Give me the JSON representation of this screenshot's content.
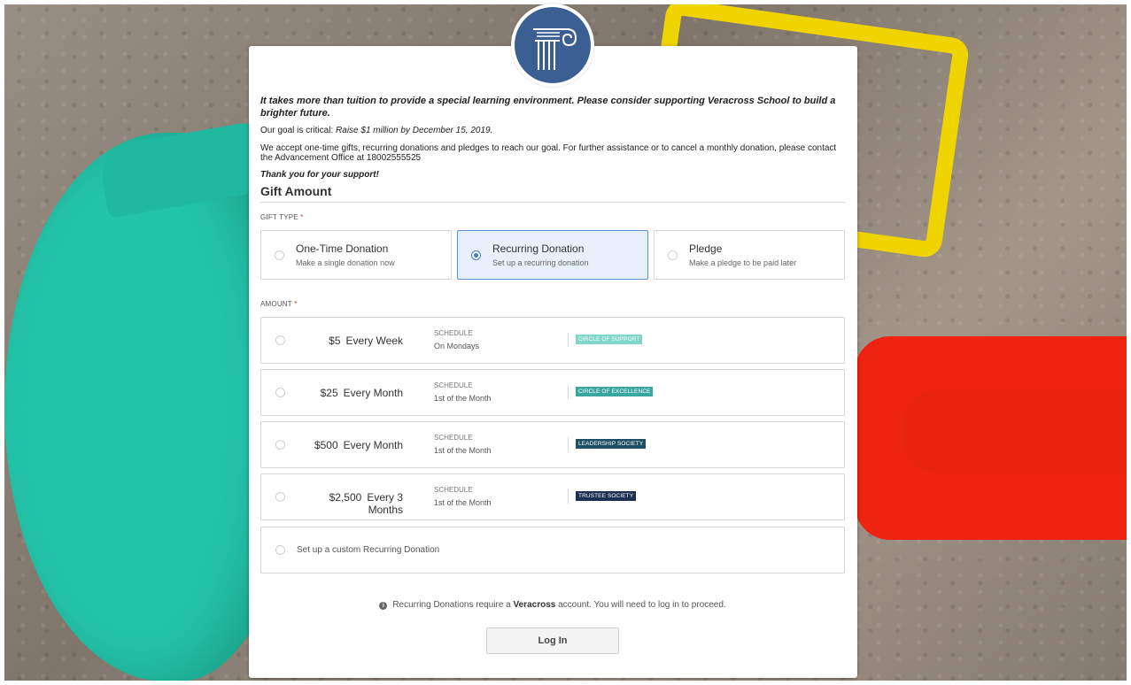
{
  "intro": {
    "line1": "It takes more than tuition to provide a special learning environment. Please consider supporting Veracross School to build a brighter future.",
    "goal_prefix": "Our goal is critical: ",
    "goal_emphasis": "Raise $1 million by December 15, 2019.",
    "line3": "We accept one-time gifts, recurring donations and pledges to reach our goal. For further assistance or to cancel a monthly donation, please contact the Advancement Office at 18002555525",
    "thanks": "Thank you for your support!"
  },
  "section_title": "Gift Amount",
  "gift_type": {
    "label": "GIFT TYPE",
    "required_mark": "*",
    "options": [
      {
        "title": "One-Time Donation",
        "subtitle": "Make a single donation now",
        "selected": false
      },
      {
        "title": "Recurring Donation",
        "subtitle": "Set up a recurring donation",
        "selected": true
      },
      {
        "title": "Pledge",
        "subtitle": "Make a pledge to be paid later",
        "selected": false
      }
    ]
  },
  "amount": {
    "label": "AMOUNT",
    "required_mark": "*",
    "rows": [
      {
        "amount": "$5",
        "frequency": "Every Week",
        "schedule_label": "SCHEDULE",
        "schedule": "On Mondays",
        "badge": "CIRCLE OF SUPPORT",
        "badge_color": "#7fd6c9"
      },
      {
        "amount": "$25",
        "frequency": "Every Month",
        "schedule_label": "SCHEDULE",
        "schedule": "1st of the Month",
        "badge": "CIRCLE OF EXCELLENCE",
        "badge_color": "#3aa6a0"
      },
      {
        "amount": "$500",
        "frequency": "Every Month",
        "schedule_label": "SCHEDULE",
        "schedule": "1st of the Month",
        "badge": "LEADERSHIP SOCIETY",
        "badge_color": "#1f4f63"
      },
      {
        "amount": "$2,500",
        "frequency": "Every 3 Months",
        "schedule_label": "SCHEDULE",
        "schedule": "1st of the Month",
        "badge": "TRUSTEE SOCIETY",
        "badge_color": "#1c2f55"
      }
    ],
    "custom": "Set up a custom Recurring Donation"
  },
  "notice": {
    "prefix": "Recurring Donations require a ",
    "brand": "Veracross",
    "suffix": " account. You will need to log in to proceed."
  },
  "login_button": "Log In",
  "colors": {
    "logo_blue": "#3b5f93",
    "selected_bg": "#e8f0fb",
    "selected_border": "#5b8fd6"
  }
}
